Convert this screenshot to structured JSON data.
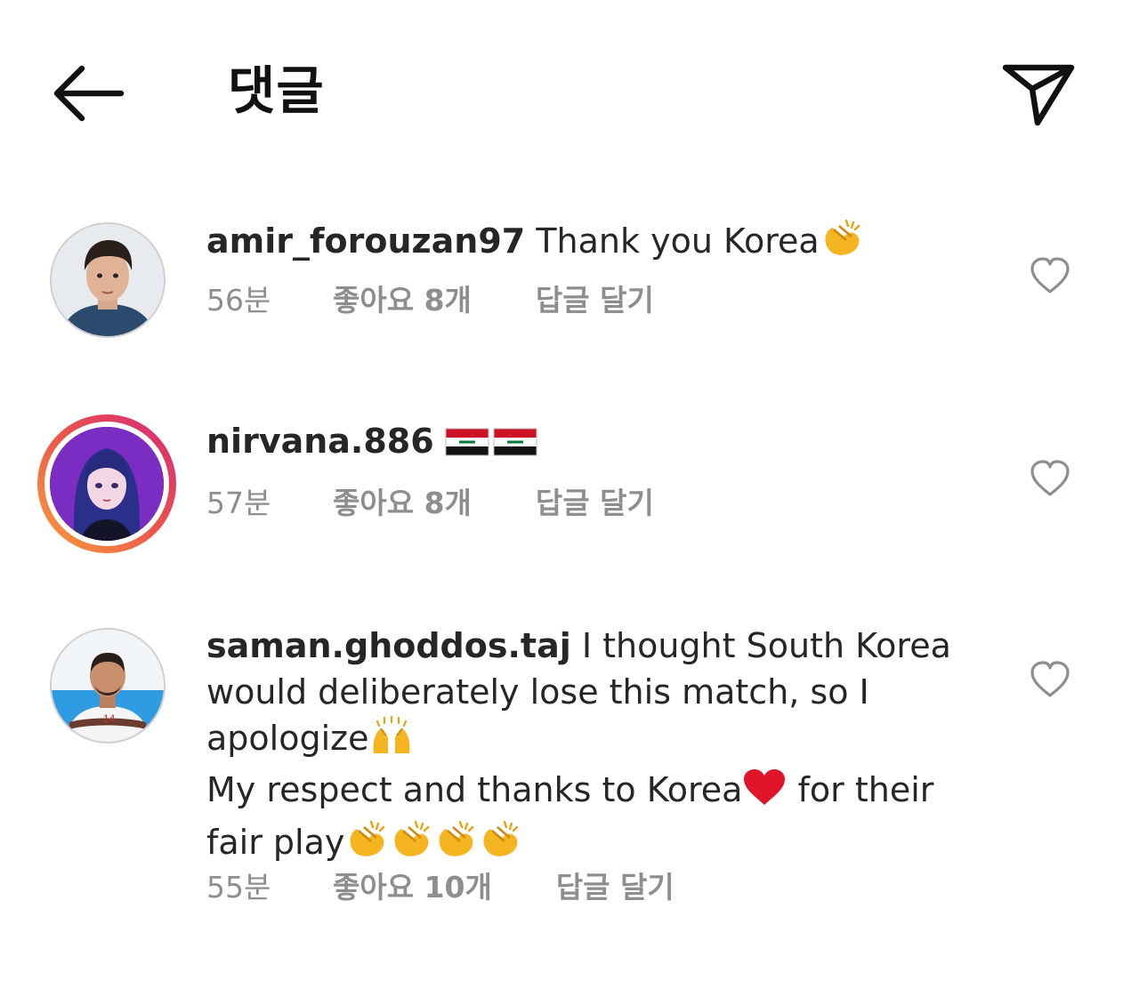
{
  "header": {
    "back_icon": "arrow-left-icon",
    "title": "댓글",
    "share_icon": "paper-plane-icon"
  },
  "comments": [
    {
      "username": "amir_forouzan97",
      "text": " Thank you Korea",
      "emoji_suffix": "clapping-hands-emoji",
      "time": "56분",
      "likes": "좋아요 8개",
      "reply": "답글 달기"
    },
    {
      "username": "nirvana.886",
      "text": " ",
      "emoji_suffix": "iraq-flag-emoji x2",
      "time": "57분",
      "likes": "좋아요 8개",
      "reply": "답글 달기"
    },
    {
      "username": "saman.ghoddos.taj",
      "text_line1": " I thought South Korea would deliberately lose this match, so I apologize",
      "text_line2": "My respect and thanks to Korea",
      "text_line2b": " for their fair play",
      "time": "55분",
      "likes": "좋아요 10개",
      "reply": "답글 달기"
    }
  ],
  "colors": {
    "text": "#262626",
    "secondary": "#8e8e8e",
    "story_ring_start": "#f9a13a",
    "story_ring_end": "#d6287a"
  }
}
